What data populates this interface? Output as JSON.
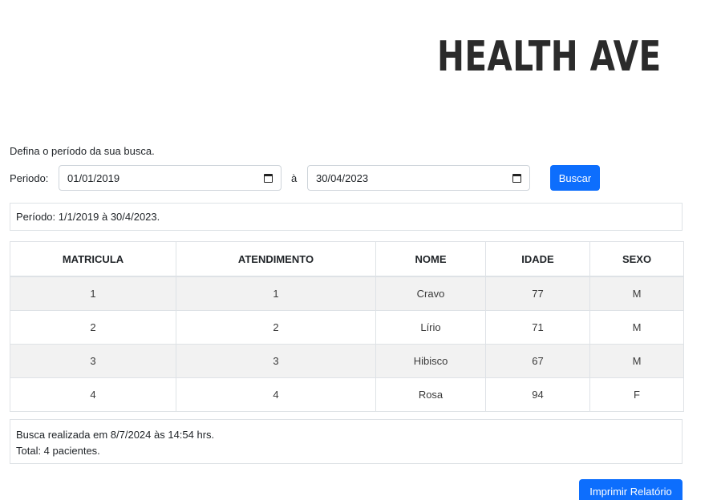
{
  "logo": {
    "text": "HEALTH AVE"
  },
  "form": {
    "instructions": "Defina o período da sua busca.",
    "periodo_label": "Periodo:",
    "date_from": "01/01/2019",
    "separator": "à",
    "date_to": "30/04/2023",
    "search_label": "Buscar"
  },
  "range_info": "Período: 1/1/2019 à 30/4/2023.",
  "table": {
    "headers": [
      "MATRICULA",
      "ATENDIMENTO",
      "NOME",
      "IDADE",
      "SEXO"
    ],
    "rows": [
      [
        "1",
        "1",
        "Cravo",
        "77",
        "M"
      ],
      [
        "2",
        "2",
        "Lírio",
        "71",
        "M"
      ],
      [
        "3",
        "3",
        "Hibisco",
        "67",
        "M"
      ],
      [
        "4",
        "4",
        "Rosa",
        "94",
        "F"
      ]
    ]
  },
  "footer": {
    "search_time": "Busca realizada em 8/7/2024 às 14:54 hrs.",
    "total": "Total: 4 pacientes."
  },
  "print_label": "Imprimir Relatório",
  "colors": {
    "primary": "#0d6efd",
    "border": "#dee2e6",
    "stripe": "#f2f2f2"
  }
}
